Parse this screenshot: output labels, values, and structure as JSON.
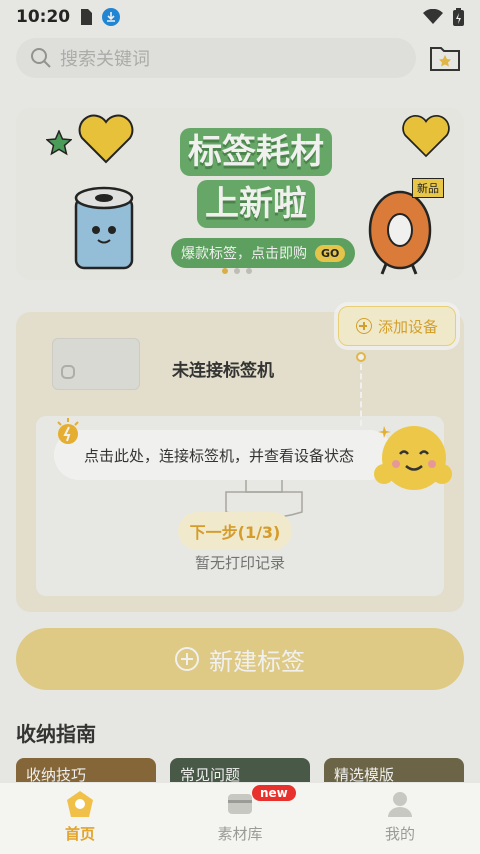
{
  "status_bar": {
    "time": "10:20"
  },
  "search": {
    "placeholder": "搜索关键词"
  },
  "banner": {
    "title_line1": "标签耗材",
    "title_line2": "上新啦",
    "subtitle": "爆款标签，点击即购",
    "go": "GO",
    "new_tag": "新品",
    "slide_count": 3,
    "active_slide": 1
  },
  "device": {
    "add_device_label": "添加设备",
    "status": "未连接标签机",
    "no_record": "暂无打印记录"
  },
  "onboarding": {
    "tip": "点击此处，连接标签机，并查看设备状态",
    "next_label": "下一步(1/3)"
  },
  "new_label_button": "新建标签",
  "guide": {
    "title": "收纳指南",
    "cards": [
      "收纳技巧",
      "常见问题",
      "精选模版"
    ]
  },
  "tabs": [
    {
      "label": "首页",
      "active": true
    },
    {
      "label": "素材库",
      "badge": "new"
    },
    {
      "label": "我的"
    }
  ],
  "colors": {
    "accent": "#e2a42b",
    "banner_green": "#6ab06c",
    "badge_red": "#e8312c"
  }
}
